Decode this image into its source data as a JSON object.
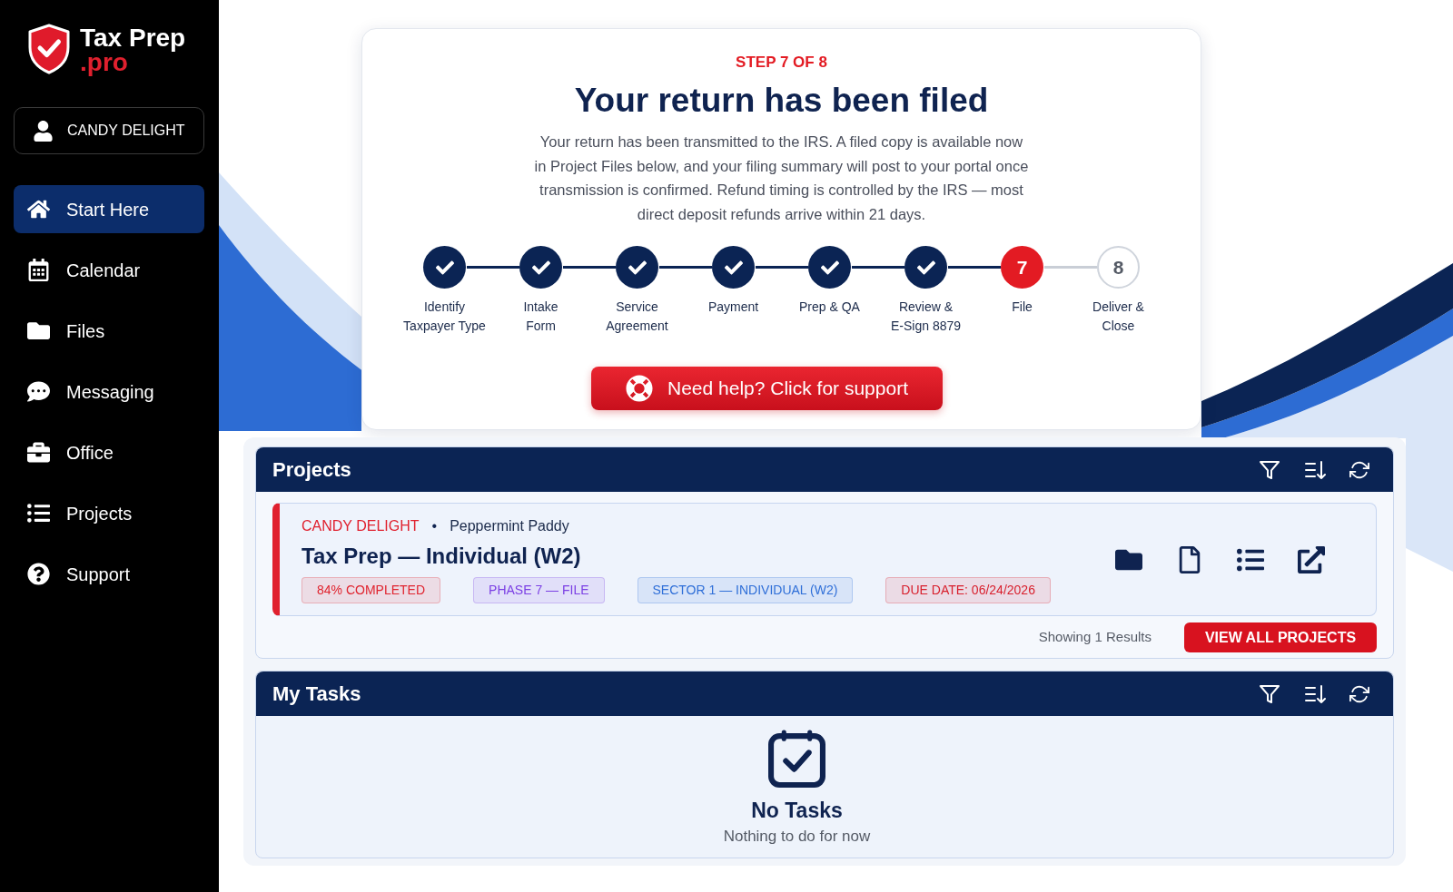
{
  "sidebar": {
    "brand": {
      "name": "Tax Prep",
      "suffix": ".pro"
    },
    "user": {
      "name": "CANDY DELIGHT"
    },
    "items": [
      {
        "label": "Start Here",
        "selected": true
      },
      {
        "label": "Calendar",
        "selected": false
      },
      {
        "label": "Files",
        "selected": false
      },
      {
        "label": "Messaging",
        "selected": false
      },
      {
        "label": "Office",
        "selected": false
      },
      {
        "label": "Projects",
        "selected": false
      },
      {
        "label": "Support",
        "selected": false
      }
    ]
  },
  "step_card": {
    "eyebrow": "STEP 7 OF 8",
    "title": "Your return has been filed",
    "body": "Your return has been transmitted to the IRS. A filed copy is available now\nin Project Files below, and your filing summary will post to your portal once\ntransmission is confirmed. Refund timing is controlled by the IRS — most\ndirect deposit refunds arrive within 21 days.",
    "steps": [
      {
        "label": "Identify\nTaxpayer Type",
        "kind": "done"
      },
      {
        "label": "Intake\nForm",
        "kind": "done"
      },
      {
        "label": "Service\nAgreement",
        "kind": "done"
      },
      {
        "label": "Payment",
        "kind": "done"
      },
      {
        "label": "Prep & QA",
        "kind": "done"
      },
      {
        "label": "Review &\nE-Sign 8879",
        "kind": "done"
      },
      {
        "label": "File",
        "kind": "current",
        "number": "7"
      },
      {
        "label": "Deliver &\nClose",
        "kind": "upcoming",
        "number": "8"
      }
    ],
    "help_button": "Need help? Click for support"
  },
  "projects": {
    "title": "Projects",
    "items": [
      {
        "client": "CANDY DELIGHT",
        "separator": "•",
        "contact": "Peppermint Paddy",
        "title": "Tax Prep — Individual (W2)",
        "tags": [
          {
            "label": "84% COMPLETED",
            "color": "#e0242f"
          },
          {
            "label": "PHASE 7 — FILE",
            "color": "#7b3fe4"
          },
          {
            "label": "SECTOR 1 — INDIVIDUAL (W2)",
            "color": "#2f6fd8"
          },
          {
            "label": "DUE DATE: 06/24/2026",
            "color": "#d81f2c"
          }
        ]
      }
    ],
    "results": "Showing 1 Results",
    "view_all_button": "VIEW ALL PROJECTS"
  },
  "tasks": {
    "title": "My Tasks",
    "empty_title": "No Tasks",
    "empty_text": "Nothing to do for now"
  }
}
